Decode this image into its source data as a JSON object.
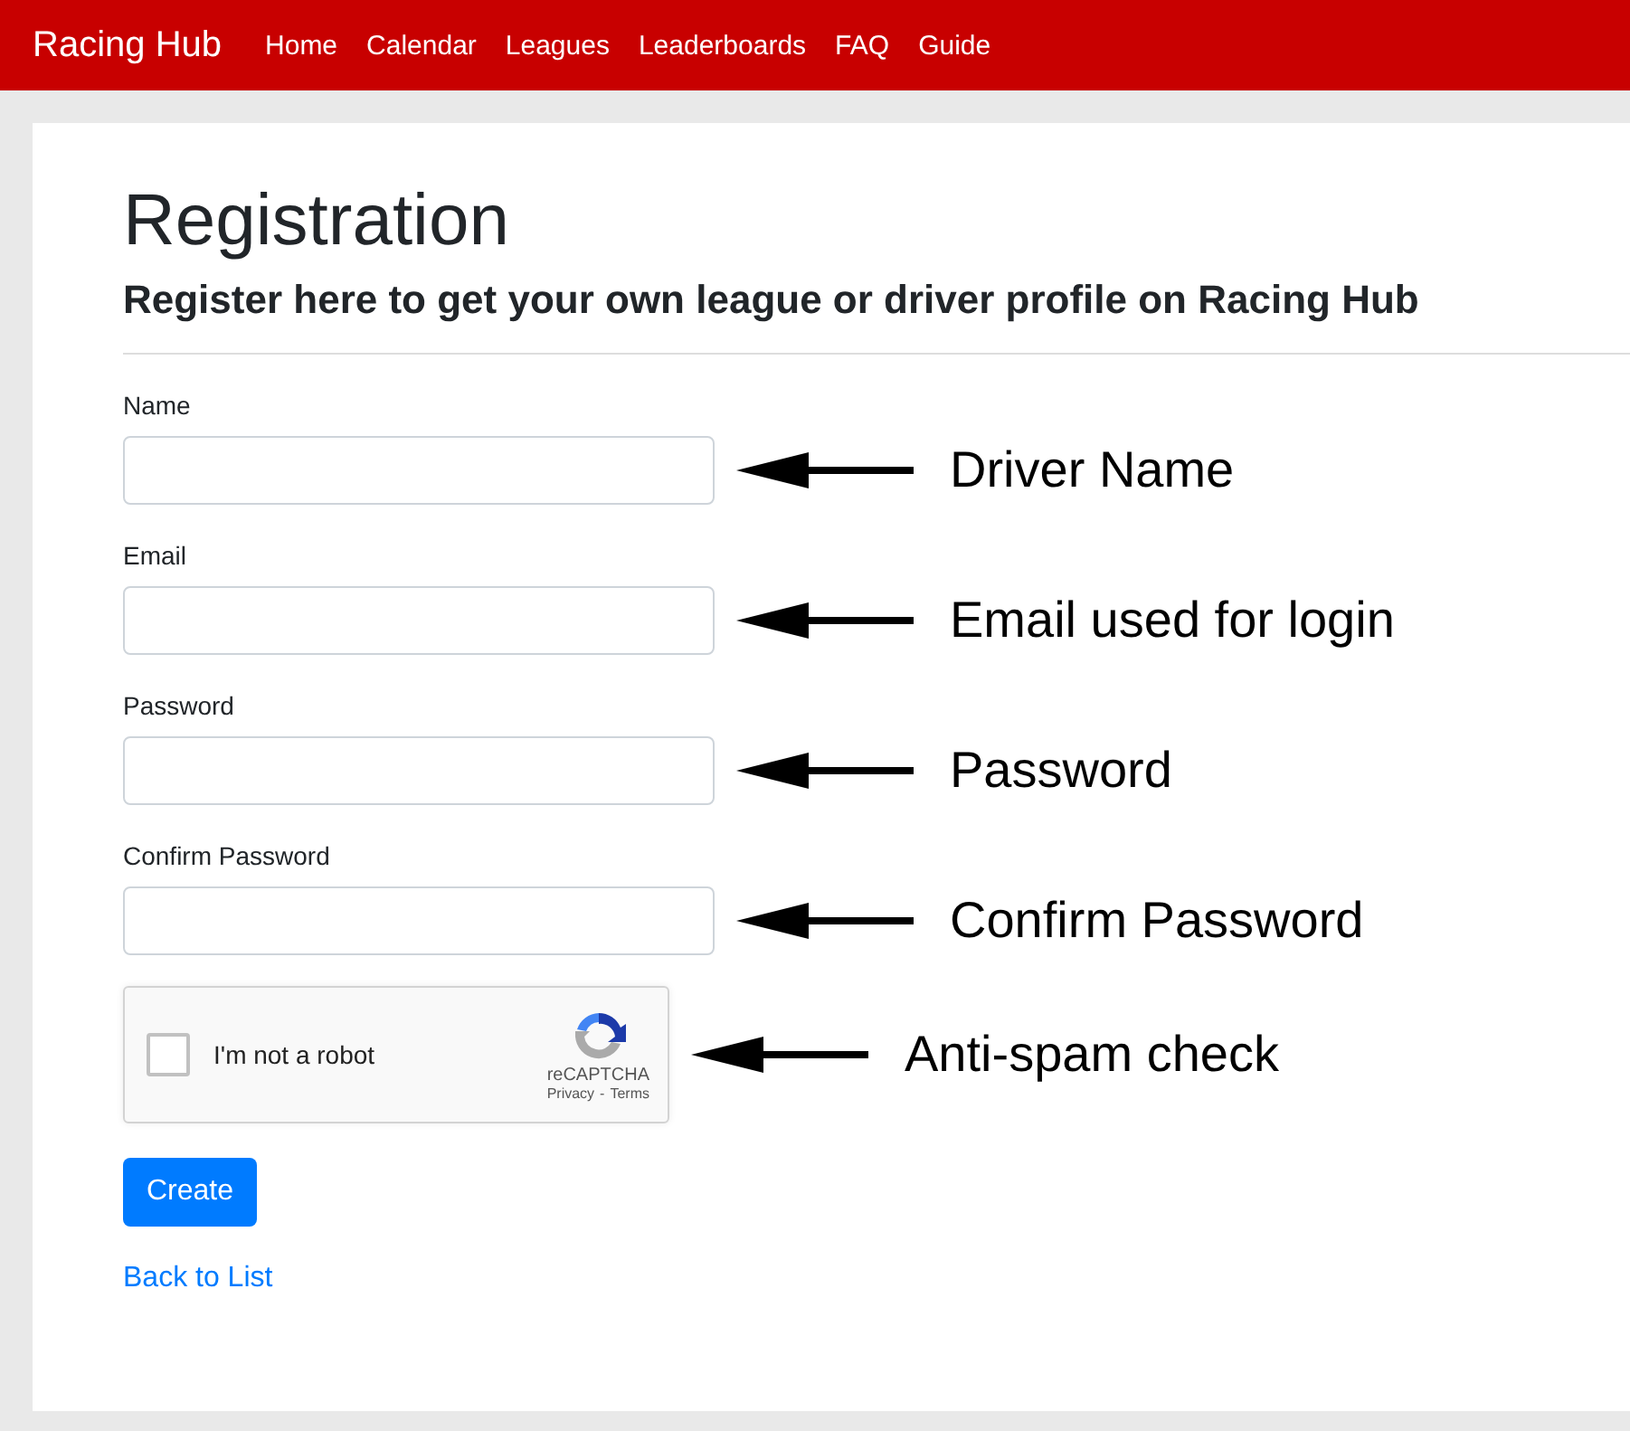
{
  "navbar": {
    "brand": "Racing Hub",
    "links": [
      "Home",
      "Calendar",
      "Leagues",
      "Leaderboards",
      "FAQ",
      "Guide"
    ]
  },
  "page": {
    "title": "Registration",
    "subtitle": "Register here to get your own league or driver profile on Racing Hub"
  },
  "fields": [
    {
      "label": "Name",
      "annotation": "Driver Name"
    },
    {
      "label": "Email",
      "annotation": "Email used for login"
    },
    {
      "label": "Password",
      "annotation": "Password"
    },
    {
      "label": "Confirm Password",
      "annotation": "Confirm Password"
    }
  ],
  "captcha": {
    "label": "I'm not a robot",
    "checked": false,
    "brand": "reCAPTCHA",
    "privacy": "Privacy",
    "separator": "-",
    "terms": "Terms",
    "annotation": "Anti-spam check"
  },
  "create_button": "Create",
  "back_link": "Back to List"
}
